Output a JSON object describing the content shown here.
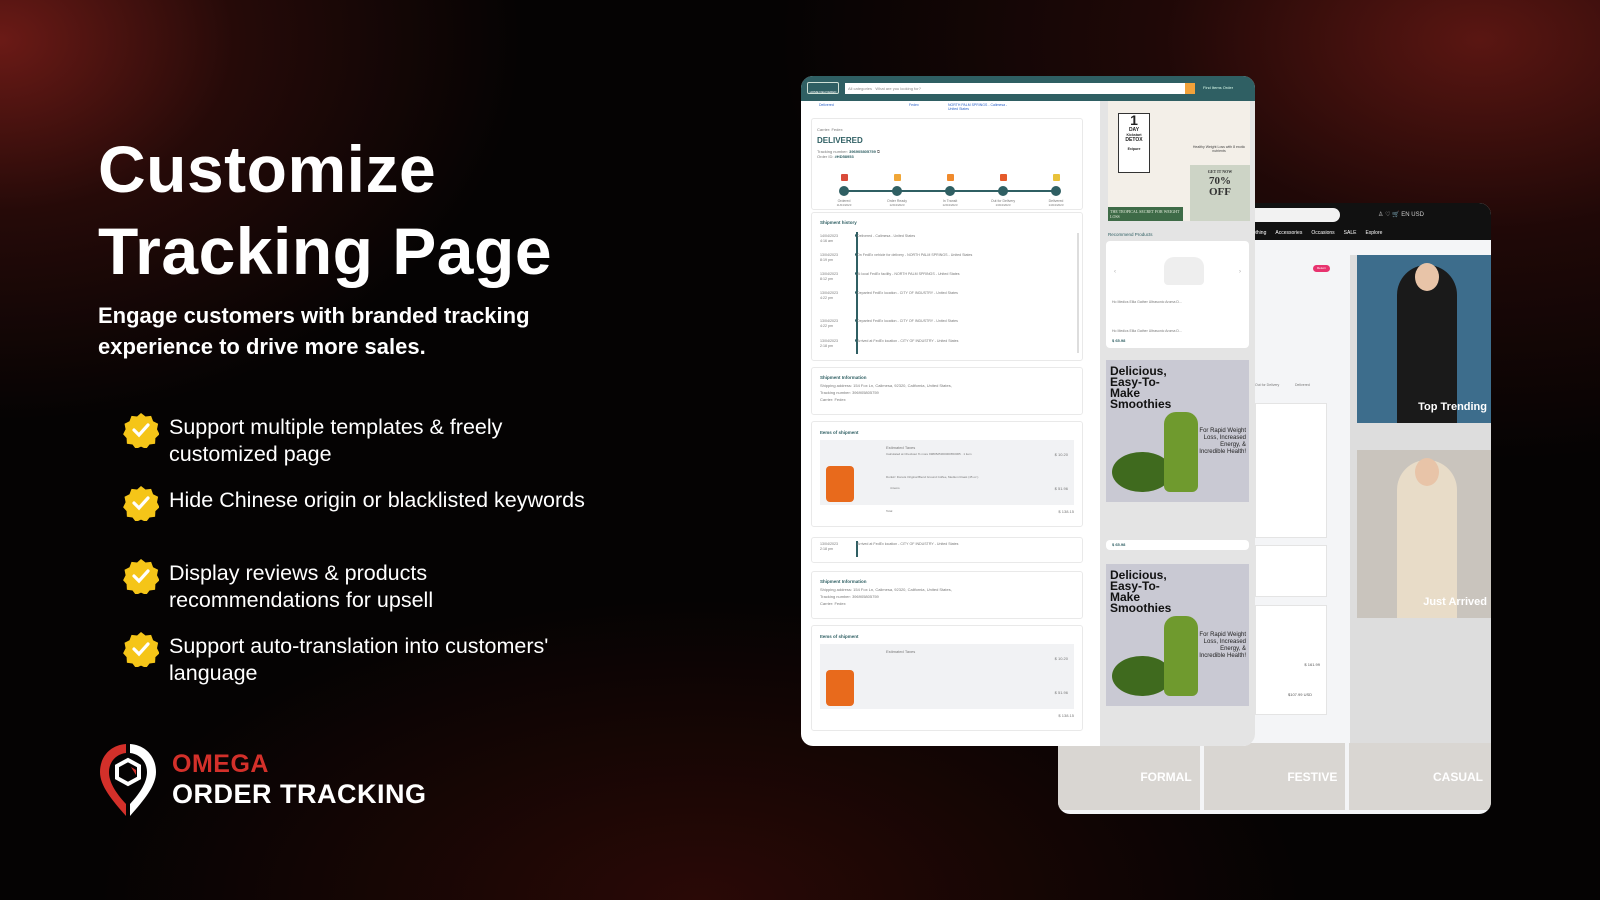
{
  "hero": {
    "title_line1": "Customize",
    "title_line2": "Tracking Page",
    "subtitle": "Engage customers with branded tracking experience to drive more sales."
  },
  "features": [
    {
      "text": "Support multiple templates & freely customized page",
      "icon": "check-badge-icon"
    },
    {
      "text": "Hide Chinese origin or blacklisted keywords",
      "icon": "check-badge-icon"
    },
    {
      "text": "Display reviews & products recommendations for upsell",
      "icon": "check-badge-icon"
    },
    {
      "text": "Support auto-translation into customers' language",
      "icon": "check-badge-icon"
    }
  ],
  "brand": {
    "line1": "OMEGA",
    "line2": "ORDER TRACKING",
    "colors": {
      "red": "#d3302a",
      "white": "#ffffff"
    }
  },
  "tracking_page": {
    "colors": {
      "header": "#2f5f63",
      "search_button": "#f2a23a"
    },
    "header": {
      "logo": "HOME DELIVERED",
      "category": "All categories",
      "search_placeholder": "What are you looking for?",
      "links": [
        "Find Items",
        "Order"
      ]
    },
    "top_row": {
      "status": "Delivered",
      "carrier": "Fedex",
      "location": "NORTH PALM SPRINGS - Calimesa - United States"
    },
    "carrier_label": "Carrier: Fedex",
    "status": "DELIVERED",
    "tracking_number_label": "Tracking number:",
    "tracking_number": "396905805759",
    "order_id_label": "Order ID:",
    "order_id": "#HD58953",
    "steps": [
      {
        "label": "Ordered",
        "date": "11/04/2023"
      },
      {
        "label": "Order Ready",
        "date": "12/04/2023"
      },
      {
        "label": "In Transit",
        "date": "12/04/2023"
      },
      {
        "label": "Out for Delivery",
        "date": "13/04/2023"
      },
      {
        "label": "Delivered",
        "date": "14/04/2023"
      }
    ],
    "history_title": "Shipment history",
    "history": [
      {
        "date": "14/04/2023",
        "time": "4:16 am",
        "event": "Delivered - Calimesa - United States"
      },
      {
        "date": "13/04/2023",
        "time": "8:19 pm",
        "event": "On FedEx vehicle for delivery - NORTH PALM SPRINGS - United States"
      },
      {
        "date": "13/04/2023",
        "time": "8:12 pm",
        "event": "At local FedEx facility - NORTH PALM SPRINGS - United States"
      },
      {
        "date": "13/04/2023",
        "time": "4:22 pm",
        "event": "Departed FedEx location - CITY OF INDUSTRY - United States"
      },
      {
        "date": "13/04/2023",
        "time": "4:22 pm",
        "event": "Departed FedEx location - CITY OF INDUSTRY - United States"
      },
      {
        "date": "13/04/2023",
        "time": "2:18 pm",
        "event": "Arrived at FedEx location - CITY OF INDUSTRY - United States"
      }
    ],
    "info_title": "Shipment Information",
    "shipping_address": "Shipping address: 154 Fox Ln, Calimesa, 92320, California, United States,",
    "info_tracking": "Tracking number: 396905805759",
    "info_carrier": "Carrier: Fedex",
    "items_title": "Items of shipment",
    "items": [
      {
        "name": "Estimated Taxes",
        "detail": "Calculated at Checkout % more 9980525300000653065 · 1 item",
        "price": "$ 10.20"
      },
      {
        "name": "Dunkin' Donuts Original Blend Ground Coffee, Medium Roast (45 oz.)",
        "detail": "4 items",
        "price": "$ 51.96"
      }
    ],
    "total_label": "Total",
    "total": "$ 138.15",
    "sidebar": {
      "ad1": {
        "big": "1",
        "day": "DAY",
        "sub": "Kickstart",
        "detox": "DETOX",
        "brand": "Exipure",
        "caption": "Healthy Weight Loss with 8 exotic nutrients",
        "cta": "GET IT NOW",
        "discount": "70%",
        "off": "OFF",
        "banner": "THE TROPICAL SECRET FOR WEIGHT LOSS"
      },
      "recommend_title": "Recommend Products",
      "product_name": "Ho Medics Ellia Gather Ultrasonic Aroma D...",
      "product_price": "$ 65.98",
      "smoothie_title": "Delicious, Easy-To-Make Smoothies",
      "smoothie_text": "For Rapid Weight Loss, Increased Energy, & Incredible Health!"
    }
  },
  "fashion_page": {
    "header": {
      "search_placeholder": "...cts",
      "lang": "EN",
      "currency": "USD"
    },
    "nav": [
      "Clothing",
      "Accessories",
      "Occasions",
      "SALE",
      "Explore"
    ],
    "badge": "Return",
    "badge_color": "#e8336f",
    "steps": [
      "Out for Delivery",
      "Delivered"
    ],
    "price": "$ 161.99",
    "total": "$107.99 USD",
    "tiles": [
      "Top Trending",
      "Just Arrived"
    ],
    "categories": [
      "FORMAL",
      "FESTIVE",
      "CASUAL"
    ]
  }
}
